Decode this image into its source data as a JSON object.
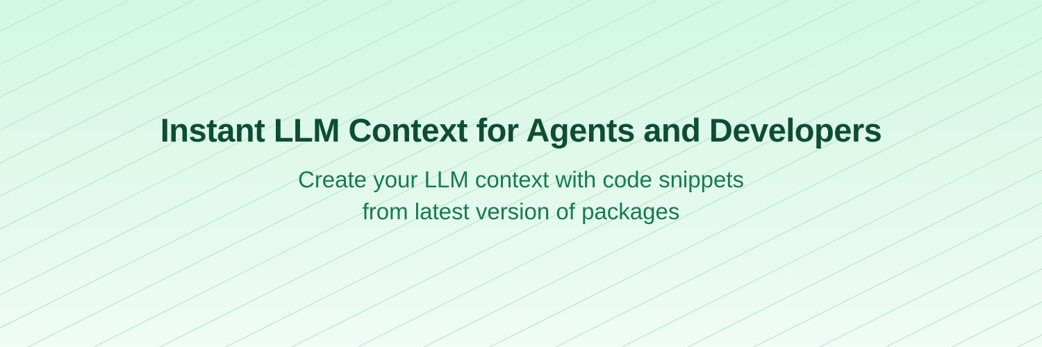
{
  "banner": {
    "headline": "Instant LLM Context for Agents and Developers",
    "subtitle_line1": "Create your LLM context with code snippets",
    "subtitle_line2": "from latest version of packages"
  },
  "colors": {
    "background_top": "#d3f7e5",
    "background_bottom": "#f0fcf5",
    "headline": "#0e4d34",
    "subtitle": "#177a50",
    "stripe": "#c4e9d4"
  }
}
